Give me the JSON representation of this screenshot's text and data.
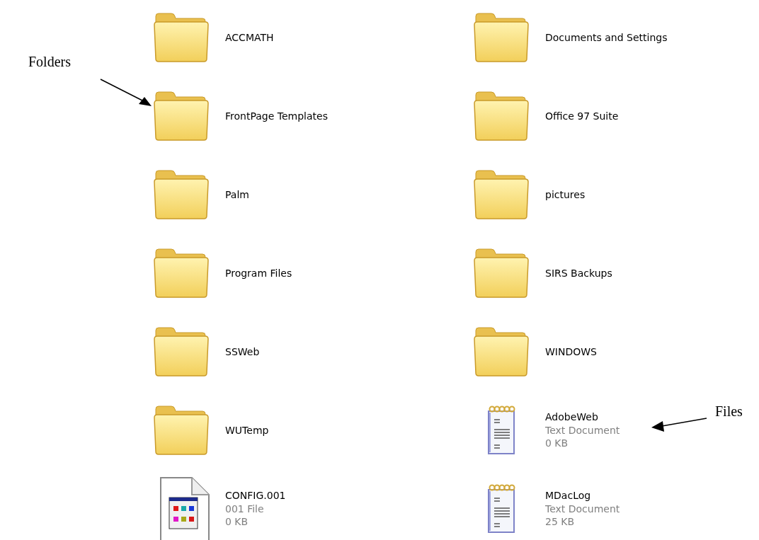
{
  "items": [
    {
      "kind": "folder",
      "name": "ACCMATH"
    },
    {
      "kind": "folder",
      "name": "FrontPage Templates"
    },
    {
      "kind": "folder",
      "name": "Palm"
    },
    {
      "kind": "folder",
      "name": "Program Files"
    },
    {
      "kind": "folder",
      "name": "SSWeb"
    },
    {
      "kind": "folder",
      "name": "WUTemp"
    },
    {
      "kind": "config",
      "name": "CONFIG.001",
      "type": "001 File",
      "size": "0 KB"
    },
    {
      "kind": "folder",
      "name": "Documents and Settings"
    },
    {
      "kind": "folder",
      "name": "Office 97 Suite"
    },
    {
      "kind": "folder",
      "name": "pictures"
    },
    {
      "kind": "folder",
      "name": "SIRS Backups"
    },
    {
      "kind": "folder",
      "name": "WINDOWS"
    },
    {
      "kind": "text",
      "name": "AdobeWeb",
      "type": "Text Document",
      "size": "0 KB"
    },
    {
      "kind": "text",
      "name": "MDacLog",
      "type": "Text Document",
      "size": "25 KB"
    }
  ],
  "annotations": [
    {
      "kind": "folders",
      "label": "Folders"
    },
    {
      "kind": "files",
      "label": "Files"
    }
  ]
}
